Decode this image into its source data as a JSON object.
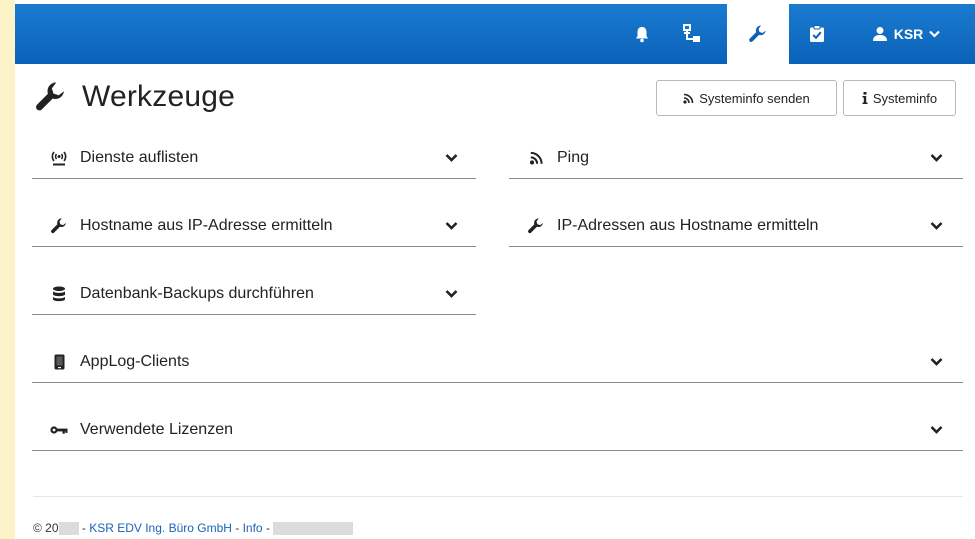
{
  "topbar": {
    "user_label": "KSR",
    "accent": "#0a62b8",
    "icons": [
      "bell-icon",
      "network-icon",
      "wrench-icon",
      "clipboard-check-icon",
      "user-icon",
      "chevron-down-icon"
    ]
  },
  "header": {
    "title": "Werkzeuge",
    "send_button_label": "Systeminfo senden",
    "info_button_label": "Systeminfo"
  },
  "sections": {
    "dienste": "Dienste auflisten",
    "ping": "Ping",
    "hostname": "Hostname aus IP-Adresse ermitteln",
    "ip": "IP-Adressen aus Hostname ermitteln",
    "backup": "Datenbank-Backups durchführen",
    "applog": "AppLog-Clients",
    "lizenzen": "Verwendete Lizenzen"
  },
  "footer": {
    "copyright": "© 20",
    "sep1": " - ",
    "company": "KSR EDV Ing. Büro GmbH",
    "sep2": " - ",
    "info": "Info",
    "sep3": " - "
  }
}
